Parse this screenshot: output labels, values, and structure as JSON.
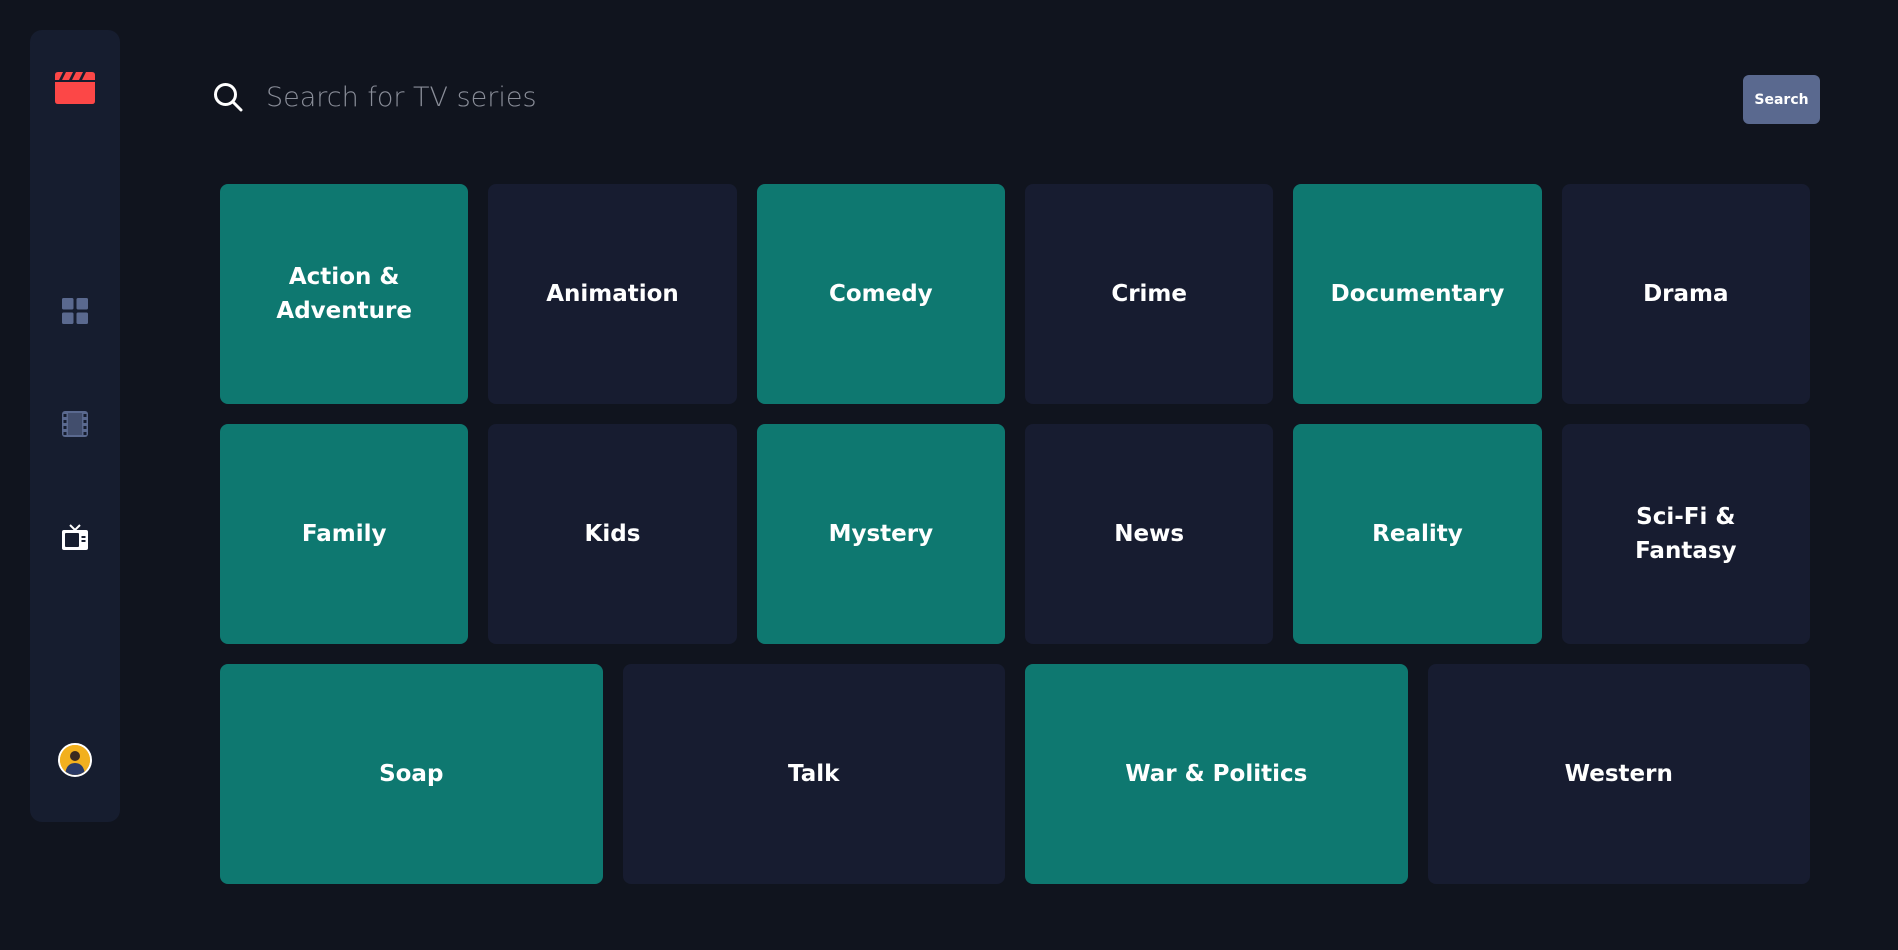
{
  "sidebar": {
    "logo_icon": "clapperboard-icon",
    "nav": [
      {
        "id": "home",
        "icon": "grid-icon"
      },
      {
        "id": "movies",
        "icon": "film-icon"
      },
      {
        "id": "tv",
        "icon": "tv-icon",
        "active": true
      }
    ],
    "avatar_icon": "user-avatar"
  },
  "search": {
    "placeholder": "Search for TV series",
    "value": "",
    "button_label": "Search"
  },
  "colors": {
    "background": "#10141e",
    "sidebar": "#161d2f",
    "accent_red": "#fc4747",
    "tile_teal": "#0e7870",
    "tile_navy": "#171c30",
    "nav_inactive": "#5a698f",
    "button": "#5a698f"
  },
  "genres": [
    {
      "label": "Action &\nAdventure",
      "color": "teal"
    },
    {
      "label": "Animation",
      "color": "navy"
    },
    {
      "label": "Comedy",
      "color": "teal"
    },
    {
      "label": "Crime",
      "color": "navy"
    },
    {
      "label": "Documentary",
      "color": "teal"
    },
    {
      "label": "Drama",
      "color": "navy"
    },
    {
      "label": "Family",
      "color": "teal"
    },
    {
      "label": "Kids",
      "color": "navy"
    },
    {
      "label": "Mystery",
      "color": "teal"
    },
    {
      "label": "News",
      "color": "navy"
    },
    {
      "label": "Reality",
      "color": "teal"
    },
    {
      "label": "Sci-Fi &\nFantasy",
      "color": "navy"
    },
    {
      "label": "Soap",
      "color": "teal"
    },
    {
      "label": "Talk",
      "color": "navy"
    },
    {
      "label": "War & Politics",
      "color": "teal"
    },
    {
      "label": "Western",
      "color": "navy"
    }
  ]
}
